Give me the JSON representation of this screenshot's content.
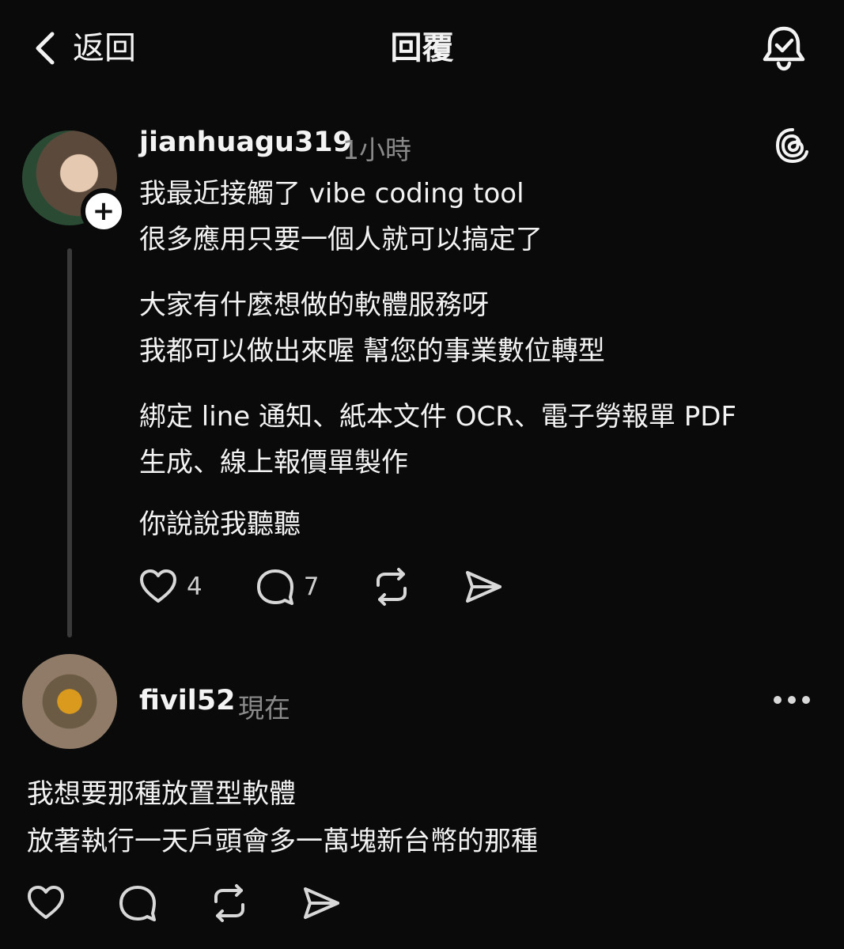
{
  "header": {
    "back_label": "返回",
    "title": "回覆"
  },
  "post": {
    "username": "jianhuagu319",
    "time": "1小時",
    "follow_symbol": "+",
    "lines": [
      "我最近接觸了 vibe coding tool",
      "很多應用只要一個人就可以搞定了",
      "大家有什麼想做的軟體服務呀",
      "我都可以做出來喔 幫您的事業數位轉型",
      "綁定 line 通知、紙本文件 OCR、電子勞報單 PDF",
      "生成、線上報價單製作",
      "你說說我聽聽"
    ],
    "likes": "4",
    "replies": "7"
  },
  "reply": {
    "username": "fivil52",
    "time": "現在",
    "lines": [
      "我想要那種放置型軟體",
      "放著執行一天戶頭會多一萬塊新台幣的那種"
    ]
  },
  "icons": {
    "back": "chevron-left-icon",
    "bell": "bell-check-icon",
    "brand": "threads-logo-icon",
    "like": "heart-icon",
    "comment": "comment-bubble-icon",
    "repost": "repost-icon",
    "share": "send-icon",
    "more": "more-dots-icon"
  },
  "colors": {
    "background": "#0a0a0a",
    "text": "#f3f3f3",
    "muted": "#8a8a8a",
    "thread_line": "#3a3a3a"
  }
}
